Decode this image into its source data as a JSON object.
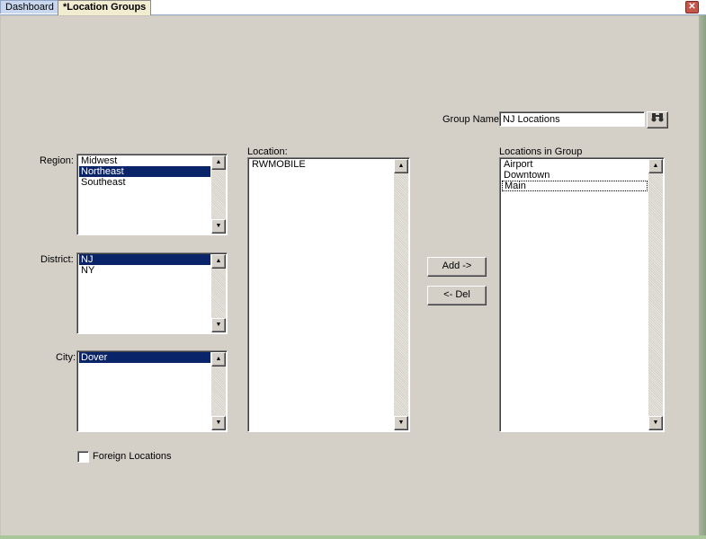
{
  "tabs": [
    {
      "label": "Dashboard"
    },
    {
      "label": "*Location Groups"
    }
  ],
  "window": {
    "close_icon": "close-icon",
    "close_glyph": "✕"
  },
  "form": {
    "group_name_label": "Group Name:",
    "group_name_value": "NJ Locations",
    "search_icon": "binoculars-icon",
    "search_glyph": "🔭",
    "region_label": "Region:",
    "region_items": [
      "Midwest",
      "Northeast",
      "Southeast"
    ],
    "region_selected": "Northeast",
    "district_label": "District:",
    "district_items": [
      "NJ",
      "NY"
    ],
    "district_selected": "NJ",
    "city_label": "City:",
    "city_items": [
      "Dover"
    ],
    "city_selected": "Dover",
    "location_label": "Location:",
    "location_items": [
      "RWMOBILE"
    ],
    "group_list_label": "Locations in Group",
    "group_items": [
      "Airport",
      "Downtown",
      "Main"
    ],
    "group_focused": "Main",
    "add_button": "Add ->",
    "del_button": "<- Del",
    "foreign_label": "Foreign Locations",
    "foreign_checked": false
  },
  "colors": {
    "selection": "#0a246a",
    "panel": "#d4d0c8"
  }
}
